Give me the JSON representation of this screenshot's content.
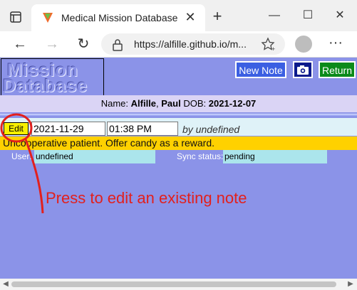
{
  "browser": {
    "tab_title": "Medical Mission Database",
    "tab_close": "✕",
    "new_tab": "+",
    "url": "https://alfille.github.io/m...",
    "window_controls": {
      "minimize": "—",
      "maximize": "☐",
      "close": "✕"
    },
    "nav": {
      "back": "←",
      "forward": "→",
      "reload": "↻"
    },
    "more": "···"
  },
  "app": {
    "logo_lines": [
      "Mission",
      "Database"
    ],
    "buttons": {
      "new_note": "New Note",
      "camera": "📷",
      "return": "Return"
    },
    "patient": {
      "name_label": "Name:",
      "last_name": "Alfille",
      "first_name": "Paul",
      "dob_label": "DOB:",
      "dob": "2021-12-07"
    },
    "note": {
      "edit_label": "Edit",
      "date": "2021-11-29",
      "time": "01:38 PM",
      "author": "by undefined",
      "text": "Uncooperative patient. Offer candy as a reward.",
      "user_label": "User:",
      "user_value": "undefined",
      "sync_label": "Sync status:",
      "sync_value": "pending"
    }
  },
  "annotation": {
    "text": "Press to edit an existing note",
    "color": "#e2201d"
  },
  "colors": {
    "page_bg": "#8b93e8",
    "note_bar": "#ffd100",
    "edit_button": "#f8f000"
  }
}
